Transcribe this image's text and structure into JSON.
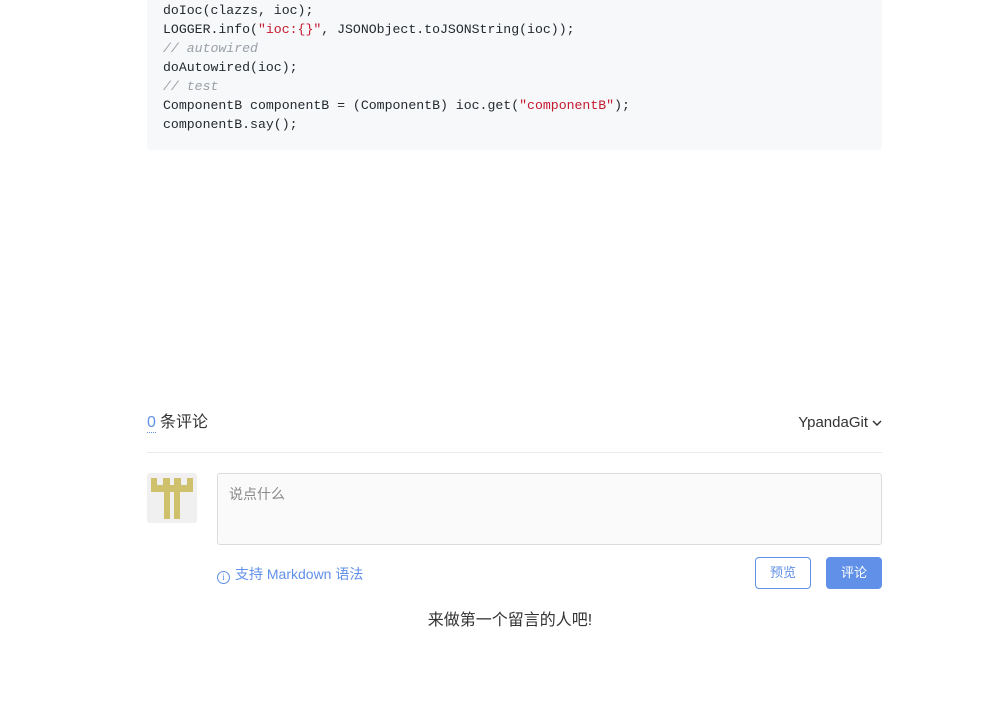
{
  "code": {
    "lines": [
      [
        {
          "t": "doIoc(clazzs, ioc);",
          "k": ""
        }
      ],
      [
        {
          "t": "LOGGER.info(",
          "k": ""
        },
        {
          "t": "\"ioc:{}\"",
          "k": "str"
        },
        {
          "t": ", JSONObject.toJSONString(ioc));",
          "k": ""
        }
      ],
      [
        {
          "t": "// autowired",
          "k": "comment"
        }
      ],
      [
        {
          "t": "doAutowired(ioc);",
          "k": ""
        }
      ],
      [
        {
          "t": "// test",
          "k": "comment"
        }
      ],
      [
        {
          "t": "ComponentB componentB = (ComponentB) ioc.get(",
          "k": ""
        },
        {
          "t": "\"componentB\"",
          "k": "str"
        },
        {
          "t": ");",
          "k": ""
        }
      ],
      [
        {
          "t": "componentB.say();",
          "k": ""
        }
      ]
    ]
  },
  "comments": {
    "count": "0",
    "count_label": "条评论",
    "user_name": "YpandaGit",
    "input_placeholder": "说点什么",
    "markdown_tip": "支持 Markdown 语法",
    "preview_label": "预览",
    "submit_label": "评论",
    "empty_message": "来做第一个留言的人吧!"
  },
  "colors": {
    "accent": "#6190e8",
    "avatar": "#cfc06b",
    "code_bg": "#f6f8fa"
  },
  "icons": {
    "dropdown": "chevron-down-icon",
    "info": "info-icon",
    "avatar": "identicon-avatar"
  }
}
